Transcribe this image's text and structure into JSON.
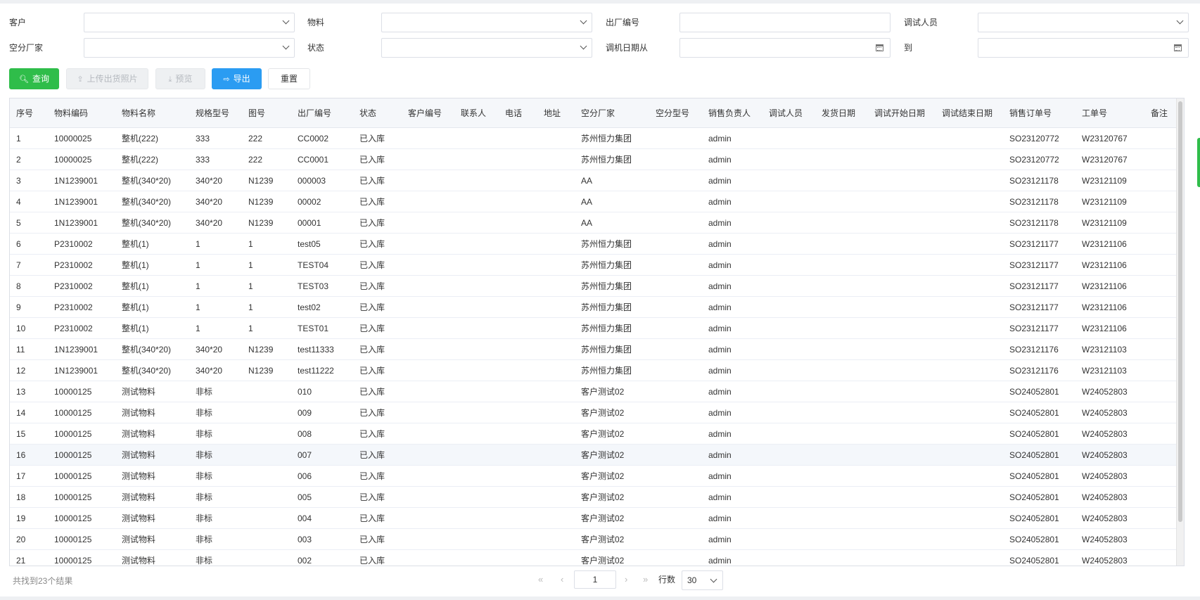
{
  "filters": {
    "customer_label": "客户",
    "material_label": "物料",
    "serial_label": "出厂编号",
    "debugger_label": "调试人员",
    "air_factory_label": "空分厂家",
    "status_label": "状态",
    "debug_date_from_label": "调机日期从",
    "to_label": "到"
  },
  "toolbar": {
    "query_label": "查询",
    "upload_label": "上传出货照片",
    "preview_label": "预览",
    "export_label": "导出",
    "reset_label": "重置"
  },
  "table": {
    "columns": [
      "序号",
      "物料编码",
      "物料名称",
      "规格型号",
      "图号",
      "出厂编号",
      "状态",
      "客户编号",
      "联系人",
      "电话",
      "地址",
      "空分厂家",
      "空分型号",
      "销售负责人",
      "调试人员",
      "发货日期",
      "调试开始日期",
      "调试结束日期",
      "销售订单号",
      "工单号",
      "备注"
    ],
    "rows": [
      [
        "1",
        "10000025",
        "整机(222)",
        "333",
        "222",
        "CC0002",
        "已入库",
        "",
        "",
        "",
        "",
        "苏州恒力集团",
        "",
        "admin",
        "",
        "",
        "",
        "",
        "SO23120772",
        "W23120767",
        ""
      ],
      [
        "2",
        "10000025",
        "整机(222)",
        "333",
        "222",
        "CC0001",
        "已入库",
        "",
        "",
        "",
        "",
        "苏州恒力集团",
        "",
        "admin",
        "",
        "",
        "",
        "",
        "SO23120772",
        "W23120767",
        ""
      ],
      [
        "3",
        "1N1239001",
        "整机(340*20)",
        "340*20",
        "N1239",
        "000003",
        "已入库",
        "",
        "",
        "",
        "",
        "AA",
        "",
        "admin",
        "",
        "",
        "",
        "",
        "SO23121178",
        "W23121109",
        ""
      ],
      [
        "4",
        "1N1239001",
        "整机(340*20)",
        "340*20",
        "N1239",
        "00002",
        "已入库",
        "",
        "",
        "",
        "",
        "AA",
        "",
        "admin",
        "",
        "",
        "",
        "",
        "SO23121178",
        "W23121109",
        ""
      ],
      [
        "5",
        "1N1239001",
        "整机(340*20)",
        "340*20",
        "N1239",
        "00001",
        "已入库",
        "",
        "",
        "",
        "",
        "AA",
        "",
        "admin",
        "",
        "",
        "",
        "",
        "SO23121178",
        "W23121109",
        ""
      ],
      [
        "6",
        "P2310002",
        "整机(1)",
        "1",
        "1",
        "test05",
        "已入库",
        "",
        "",
        "",
        "",
        "苏州恒力集团",
        "",
        "admin",
        "",
        "",
        "",
        "",
        "SO23121177",
        "W23121106",
        ""
      ],
      [
        "7",
        "P2310002",
        "整机(1)",
        "1",
        "1",
        "TEST04",
        "已入库",
        "",
        "",
        "",
        "",
        "苏州恒力集团",
        "",
        "admin",
        "",
        "",
        "",
        "",
        "SO23121177",
        "W23121106",
        ""
      ],
      [
        "8",
        "P2310002",
        "整机(1)",
        "1",
        "1",
        "TEST03",
        "已入库",
        "",
        "",
        "",
        "",
        "苏州恒力集团",
        "",
        "admin",
        "",
        "",
        "",
        "",
        "SO23121177",
        "W23121106",
        ""
      ],
      [
        "9",
        "P2310002",
        "整机(1)",
        "1",
        "1",
        "test02",
        "已入库",
        "",
        "",
        "",
        "",
        "苏州恒力集团",
        "",
        "admin",
        "",
        "",
        "",
        "",
        "SO23121177",
        "W23121106",
        ""
      ],
      [
        "10",
        "P2310002",
        "整机(1)",
        "1",
        "1",
        "TEST01",
        "已入库",
        "",
        "",
        "",
        "",
        "苏州恒力集团",
        "",
        "admin",
        "",
        "",
        "",
        "",
        "SO23121177",
        "W23121106",
        ""
      ],
      [
        "11",
        "1N1239001",
        "整机(340*20)",
        "340*20",
        "N1239",
        "test11333",
        "已入库",
        "",
        "",
        "",
        "",
        "苏州恒力集团",
        "",
        "admin",
        "",
        "",
        "",
        "",
        "SO23121176",
        "W23121103",
        ""
      ],
      [
        "12",
        "1N1239001",
        "整机(340*20)",
        "340*20",
        "N1239",
        "test11222",
        "已入库",
        "",
        "",
        "",
        "",
        "苏州恒力集团",
        "",
        "admin",
        "",
        "",
        "",
        "",
        "SO23121176",
        "W23121103",
        ""
      ],
      [
        "13",
        "10000125",
        "测试物料",
        "非标",
        "",
        "010",
        "已入库",
        "",
        "",
        "",
        "",
        "客户测试02",
        "",
        "admin",
        "",
        "",
        "",
        "",
        "SO24052801",
        "W24052803",
        ""
      ],
      [
        "14",
        "10000125",
        "测试物料",
        "非标",
        "",
        "009",
        "已入库",
        "",
        "",
        "",
        "",
        "客户测试02",
        "",
        "admin",
        "",
        "",
        "",
        "",
        "SO24052801",
        "W24052803",
        ""
      ],
      [
        "15",
        "10000125",
        "测试物料",
        "非标",
        "",
        "008",
        "已入库",
        "",
        "",
        "",
        "",
        "客户测试02",
        "",
        "admin",
        "",
        "",
        "",
        "",
        "SO24052801",
        "W24052803",
        ""
      ],
      [
        "16",
        "10000125",
        "测试物料",
        "非标",
        "",
        "007",
        "已入库",
        "",
        "",
        "",
        "",
        "客户测试02",
        "",
        "admin",
        "",
        "",
        "",
        "",
        "SO24052801",
        "W24052803",
        ""
      ],
      [
        "17",
        "10000125",
        "测试物料",
        "非标",
        "",
        "006",
        "已入库",
        "",
        "",
        "",
        "",
        "客户测试02",
        "",
        "admin",
        "",
        "",
        "",
        "",
        "SO24052801",
        "W24052803",
        ""
      ],
      [
        "18",
        "10000125",
        "测试物料",
        "非标",
        "",
        "005",
        "已入库",
        "",
        "",
        "",
        "",
        "客户测试02",
        "",
        "admin",
        "",
        "",
        "",
        "",
        "SO24052801",
        "W24052803",
        ""
      ],
      [
        "19",
        "10000125",
        "测试物料",
        "非标",
        "",
        "004",
        "已入库",
        "",
        "",
        "",
        "",
        "客户测试02",
        "",
        "admin",
        "",
        "",
        "",
        "",
        "SO24052801",
        "W24052803",
        ""
      ],
      [
        "20",
        "10000125",
        "测试物料",
        "非标",
        "",
        "003",
        "已入库",
        "",
        "",
        "",
        "",
        "客户测试02",
        "",
        "admin",
        "",
        "",
        "",
        "",
        "SO24052801",
        "W24052803",
        ""
      ],
      [
        "21",
        "10000125",
        "测试物料",
        "非标",
        "",
        "002",
        "已入库",
        "",
        "",
        "",
        "",
        "客户测试02",
        "",
        "admin",
        "",
        "",
        "",
        "",
        "SO24052801",
        "W24052803",
        ""
      ]
    ],
    "highlighted_row": 16
  },
  "footer": {
    "summary": "共找到23个结果",
    "page_current": "1",
    "rows_label": "行数",
    "rows_per_page": "30"
  },
  "icons": {
    "search": "search-icon",
    "upload": "upload-icon",
    "preview": "download-icon",
    "export": "export-icon",
    "dropdown": "chevron-down-icon",
    "calendar": "calendar-icon",
    "first_page": "first-page-icon",
    "prev_page": "prev-page-icon",
    "next_page": "next-page-icon",
    "last_page": "last-page-icon"
  },
  "colors": {
    "query_button": "#2fbd4a",
    "export_button": "#2b9cf2",
    "disabled_button": "#eef0f2",
    "highlight_row": "#f4f7fb"
  }
}
